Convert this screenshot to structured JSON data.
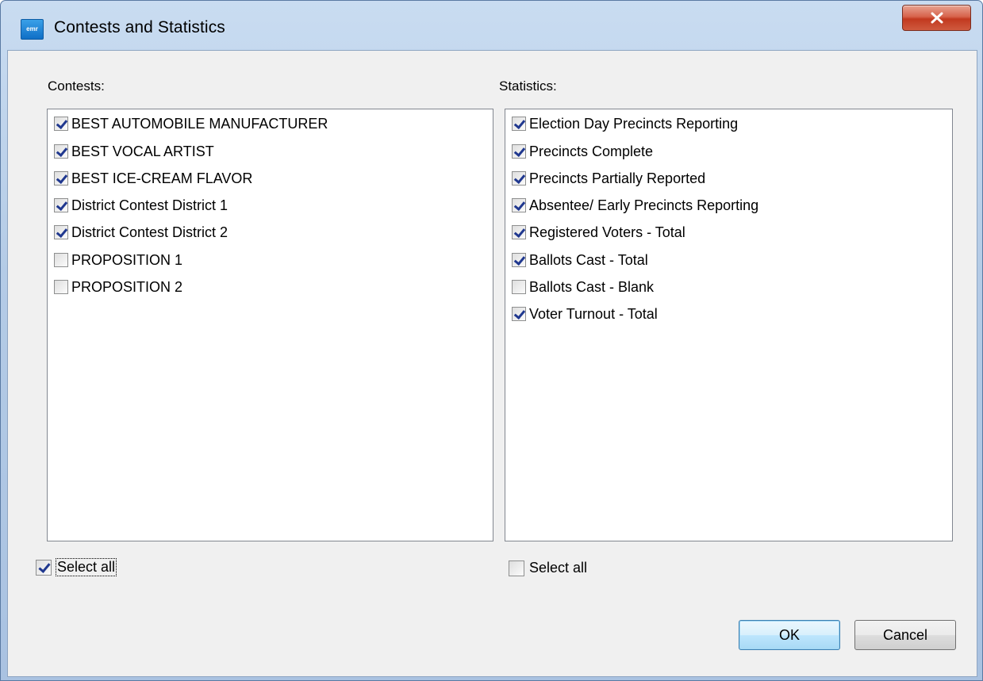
{
  "window": {
    "title": "Contests and Statistics",
    "icon": "app-icon",
    "icon_text": "emr"
  },
  "contests": {
    "label": "Contests:",
    "items": [
      {
        "label": "BEST AUTOMOBILE MANUFACTURER",
        "checked": true
      },
      {
        "label": "BEST VOCAL ARTIST",
        "checked": true
      },
      {
        "label": "BEST ICE-CREAM FLAVOR",
        "checked": true
      },
      {
        "label": "District Contest District 1",
        "checked": true
      },
      {
        "label": "District Contest District 2",
        "checked": true
      },
      {
        "label": "PROPOSITION 1",
        "checked": false
      },
      {
        "label": "PROPOSITION 2",
        "checked": false
      }
    ],
    "select_all": {
      "label": "Select all",
      "checked": true
    }
  },
  "statistics": {
    "label": "Statistics:",
    "items": [
      {
        "label": "Election Day Precincts Reporting",
        "checked": true
      },
      {
        "label": "Precincts Complete",
        "checked": true
      },
      {
        "label": "Precincts Partially Reported",
        "checked": true
      },
      {
        "label": "Absentee/ Early Precincts Reporting",
        "checked": true
      },
      {
        "label": "Registered Voters - Total",
        "checked": true
      },
      {
        "label": "Ballots Cast - Total",
        "checked": true
      },
      {
        "label": "Ballots Cast - Blank",
        "checked": false
      },
      {
        "label": "Voter Turnout - Total",
        "checked": true
      }
    ],
    "select_all": {
      "label": "Select all",
      "checked": false
    }
  },
  "buttons": {
    "ok": "OK",
    "cancel": "Cancel"
  },
  "colors": {
    "titlebar": "#b4cbe6",
    "close_button": "#c2391f",
    "client": "#f0f0f0",
    "default_button": "#bee6fd"
  }
}
